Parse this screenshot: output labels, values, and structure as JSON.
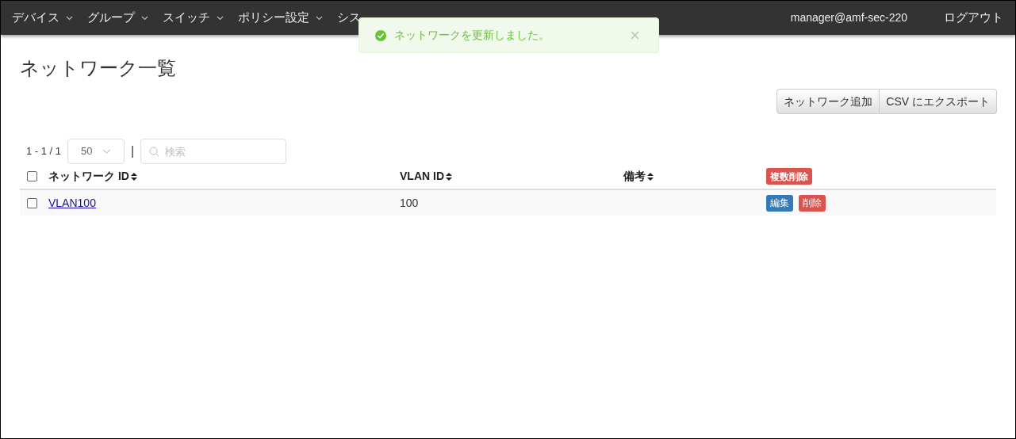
{
  "navbar": {
    "items": [
      {
        "label": "デバイス",
        "dropdown": true
      },
      {
        "label": "グループ",
        "dropdown": true
      },
      {
        "label": "スイッチ",
        "dropdown": true
      },
      {
        "label": "ポリシー設定",
        "dropdown": true
      },
      {
        "label": "シス"
      }
    ],
    "user": "manager@amf-sec-220",
    "logout": "ログアウト"
  },
  "toast": {
    "message": "ネットワークを更新しました。"
  },
  "page_title": "ネットワーク一覧",
  "actions": [
    "ネットワーク追加",
    "CSV にエクスポート"
  ],
  "pager": {
    "range": "1 - 1 / 1",
    "page_size": "50",
    "separator": "|"
  },
  "search": {
    "placeholder": "検索"
  },
  "table": {
    "header_checked": false,
    "columns": [
      {
        "label": "ネットワーク ID",
        "sortable": true
      },
      {
        "label": "VLAN ID",
        "sortable": true
      },
      {
        "label": "備考",
        "sortable": true
      }
    ],
    "bulk_delete": "複数削除",
    "rows": [
      {
        "checked": false,
        "network_id": "VLAN100",
        "vlan_id": "100",
        "edit": "編集",
        "delete": "削除"
      }
    ]
  }
}
